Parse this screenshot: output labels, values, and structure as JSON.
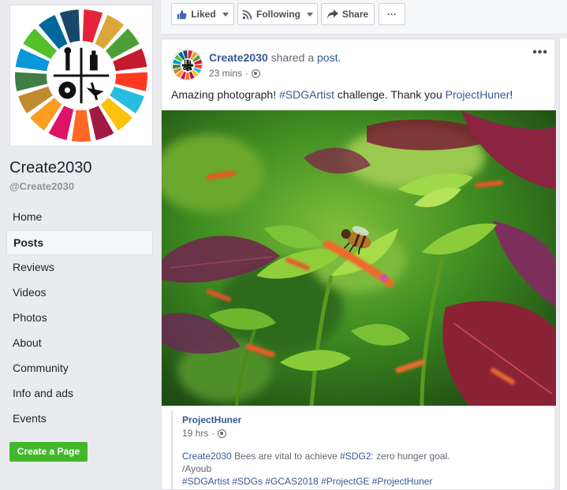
{
  "page": {
    "name": "Create2030",
    "handle": "@Create2030"
  },
  "nav": [
    {
      "label": "Home",
      "active": false
    },
    {
      "label": "Posts",
      "active": true
    },
    {
      "label": "Reviews",
      "active": false
    },
    {
      "label": "Videos",
      "active": false
    },
    {
      "label": "Photos",
      "active": false
    },
    {
      "label": "About",
      "active": false
    },
    {
      "label": "Community",
      "active": false
    },
    {
      "label": "Info and ads",
      "active": false
    },
    {
      "label": "Events",
      "active": false
    }
  ],
  "create_page_label": "Create a Page",
  "actions": {
    "liked": "Liked",
    "following": "Following",
    "share": "Share",
    "more": "···"
  },
  "post": {
    "author": "Create2030",
    "shared_text": "shared a",
    "shared_link": "post.",
    "time": "23 mins",
    "separator": "·",
    "more": "•••",
    "text_before": "Amazing photograph!",
    "hashtag": "#SDGArtist",
    "text_middle": "challenge. Thank you",
    "mention": "ProjectHuner",
    "text_end": "!"
  },
  "quoted": {
    "author": "ProjectHuner",
    "time": "19 hrs",
    "separator": "·",
    "line1_link": "Create2030",
    "line1_text": "Bees are vital to achieve",
    "line1_tag": "#SDG2",
    "line1_end": ": zero hunger goal.",
    "line2": "/Ayoub",
    "hashtags": "#SDGArtist #SDGs #GCAS2018 #ProjectGE #ProjectHuner"
  },
  "colors": {
    "link": "#365899",
    "green_button": "#42b72a",
    "sdg_wheel": [
      "#e5243b",
      "#dda63a",
      "#4c9f38",
      "#c5192d",
      "#ff3a21",
      "#26bde2",
      "#fcc30b",
      "#a21942",
      "#fd6925",
      "#dd1367",
      "#fd9d24",
      "#bf8b2e",
      "#3f7e44",
      "#0a97d9",
      "#56c02b",
      "#00689d",
      "#19486a"
    ]
  },
  "icons": [
    "thumbs-up-icon",
    "wifi-rss-icon",
    "share-arrow-icon",
    "globe-icon",
    "more-icon",
    "caret-down-icon"
  ]
}
